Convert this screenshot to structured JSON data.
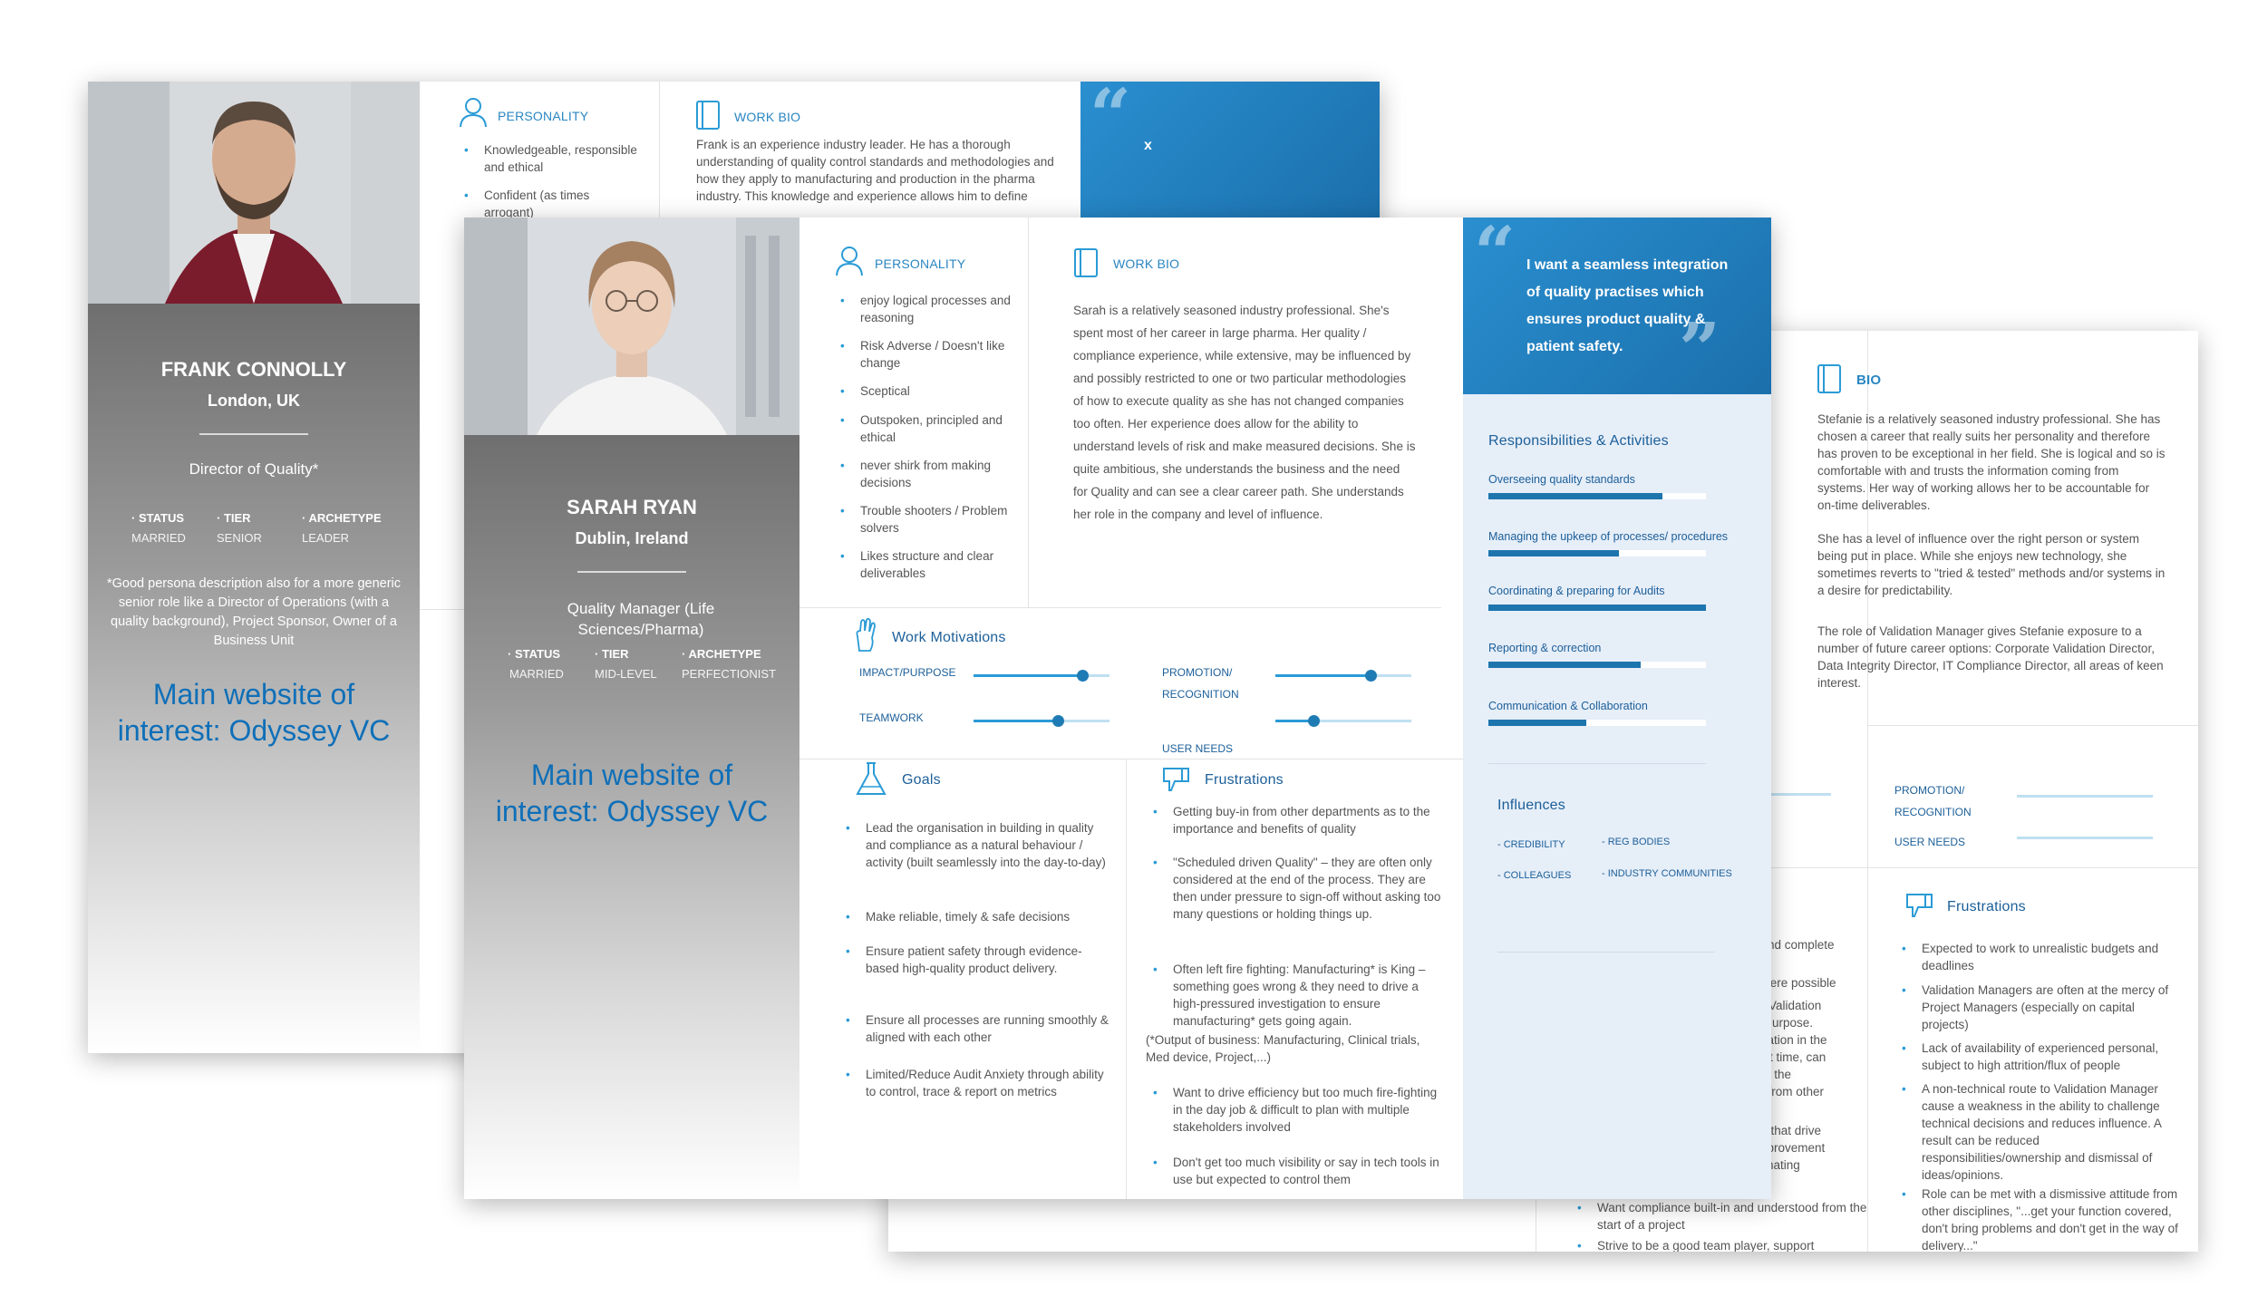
{
  "frank": {
    "name": "FRANK CONNOLLY",
    "location": "London, UK",
    "role": "Director of Quality*",
    "stats": [
      {
        "label": "· STATUS",
        "value": "MARRIED"
      },
      {
        "label": "· TIER",
        "value": "SENIOR"
      },
      {
        "label": "· ARCHETYPE",
        "value": "LEADER"
      }
    ],
    "note": "*Good persona description also for a more generic senior role like a Director of Operations (with a quality background), Project Sponsor, Owner of a Business Unit",
    "website": "Main website of interest: Odyssey VC",
    "personality_title": "PERSONALITY",
    "personality": [
      "Knowledgeable, responsible and ethical",
      "Confident (as times arrogant)"
    ],
    "workbio_title": "WORK BIO",
    "workbio": "Frank is an experience industry leader. He has a thorough understanding of quality control standards and methodologies and how they apply to manufacturing and production in the pharma industry. This knowledge and experience allows him to define",
    "quote_text": "x"
  },
  "sarah": {
    "name": "SARAH RYAN",
    "location": "Dublin, Ireland",
    "role": "Quality Manager (Life Sciences/Pharma)",
    "stats": [
      {
        "label": "· STATUS",
        "value": "MARRIED"
      },
      {
        "label": "· TIER",
        "value": "MID-LEVEL"
      },
      {
        "label": "· ARCHETYPE",
        "value": "PERFECTIONIST"
      }
    ],
    "website": "Main website of interest: Odyssey VC",
    "personality_title": "PERSONALITY",
    "personality": [
      "enjoy logical processes and reasoning",
      "Risk Adverse / Doesn't like change",
      "Sceptical",
      "Outspoken, principled and ethical",
      "never shirk from making decisions",
      "Trouble shooters / Problem solvers",
      "Likes structure and clear deliverables"
    ],
    "workbio_title": "WORK BIO",
    "workbio": "Sarah is a relatively seasoned industry professional. She's spent most of her career in large pharma. Her quality / compliance experience, while extensive, may be influenced by and possibly restricted to one or two particular methodologies of how to execute quality as she has not changed companies too often. Her experience does allow for the ability to understand levels of risk and make measured decisions. She is quite ambitious, she understands the business and the need for Quality and can see a clear career path. She understands her role in the company and level of influence.",
    "quote": "I want a seamless integration of quality practises which ensures product quality & patient safety.",
    "resp_title": "Responsibilities & Activities",
    "responsibilities": [
      {
        "label": "Overseeing quality standards",
        "level": 0.8
      },
      {
        "label": "Managing the upkeep of  processes/ procedures",
        "level": 0.6
      },
      {
        "label": "Coordinating & preparing for Audits",
        "level": 1.0
      },
      {
        "label": "Reporting & correction",
        "level": 0.7
      },
      {
        "label": "Communication & Collaboration",
        "level": 0.45
      }
    ],
    "influences_title": "Influences",
    "influences": [
      "- CREDIBILITY",
      "- REG BODIES",
      "- COLLEAGUES",
      "- INDUSTRY COMMUNITIES"
    ],
    "motivations_title": "Work Motivations",
    "motivations": [
      {
        "label": "IMPACT/PURPOSE",
        "level": 0.8
      },
      {
        "label": "PROMOTION/ RECOGNITION",
        "level": 0.7
      },
      {
        "label": "TEAMWORK",
        "level": 0.62
      },
      {
        "label": "USER NEEDS",
        "level": 0.28
      }
    ],
    "goals_title": "Goals",
    "goals": [
      "Lead the organisation in building in quality and compliance as a natural behaviour / activity (built seamlessly into the day-to-day)",
      "Make reliable, timely & safe decisions",
      "Ensure patient safety through evidence-based high-quality product delivery.",
      "Ensure all processes are running smoothly & aligned with each other",
      "Limited/Reduce Audit Anxiety through ability to control, trace & report on metrics"
    ],
    "frustrations_title": "Frustrations",
    "frustrations": [
      "Getting buy-in from other departments as to the importance and benefits of quality",
      "\"Scheduled driven Quality\" – they are often only considered at the end of the process. They are then under pressure to sign-off without asking too many questions or holding things up.",
      "Often left fire fighting: Manufacturing* is King – something goes wrong & they need to drive a high-pressured investigation to ensure manufacturing* gets going again.",
      "Want to drive efficiency but too much fire-fighting in the day job & difficult to plan with multiple stakeholders involved",
      "Don't get too much visibility or say in tech tools in use but expected to control them"
    ],
    "frustration_note": "(*Output of business: Manufacturing, Clinical trials, Med device, Project,...)"
  },
  "stefanie": {
    "bio_title": "BIO",
    "bio": [
      "Stefanie is a relatively seasoned industry professional. She has chosen a career that really suits her personality and therefore has proven to be exceptional in her field. She is logical and so is comfortable with and trusts the information coming from systems. Her way of working allows her to be accountable for on-time deliverables.",
      "She has a level of influence over the right person or system being put in place. While she enjoys new technology, she sometimes reverts to \"tried & tested\" methods and/or systems in a desire for predictability.",
      "The role of Validation Manager gives Stefanie exposure to a number of future career options: Corporate Validation Director, Data Integrity Director, IT Compliance Director, all areas of keen interest."
    ],
    "motivation_labels": [
      "PROMOTION/ RECOGNITION",
      "USER NEEDS"
    ],
    "frustrations_title": "Frustrations",
    "frustrations": [
      "Expected to work to unrealistic budgets and deadlines",
      "Validation Managers are often at the mercy of Project Managers (especially on capital projects)",
      "Lack of availability of experienced personal, subject to high attrition/flux of people",
      "A non-technical route to Validation Manager cause a weakness in the ability to challenge technical decisions and reduces influence. A result can be reduced responsibilities/ownership and dismissal of ideas/opinions.",
      "Role can be met with a dismissive attitude from other disciplines, \"...get your function covered, don't bring problems and don't get in the way of delivery...\""
    ],
    "goal_fragments": [
      "nd complete",
      "vere possible",
      "Validation",
      "urpose.",
      "dation in the",
      "t time, can",
      "e the",
      "y from other",
      "s that drive",
      "nprovement",
      "inating"
    ],
    "goals_bottom": [
      "Want compliance built-in and understood from the start of a project",
      "Strive to be a good team player, support"
    ]
  }
}
